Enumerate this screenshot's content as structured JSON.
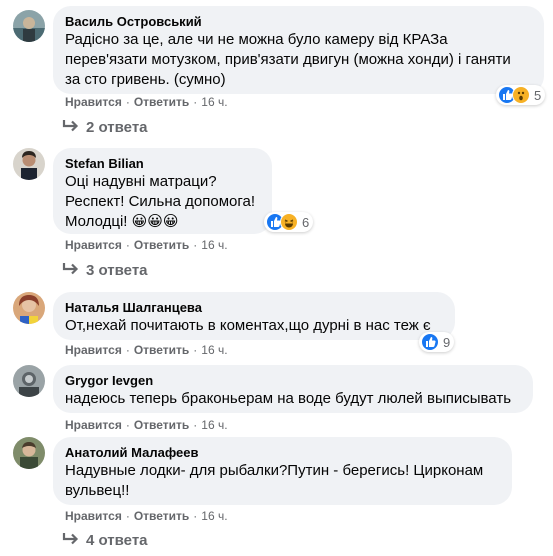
{
  "actions": {
    "like": "Нравится",
    "reply": "Ответить",
    "dot": "·"
  },
  "comments": [
    {
      "author": "Василь Островський",
      "text": "Радісно за це, але чи не можна було камеру від КРАЗа\nперев'язати мотузком, прив'язати двигун (можна хонди) і ганяти\nза сто гривень. (сумно)",
      "time": "16 ч.",
      "reactions": {
        "icons": [
          "like-icon",
          "wow-icon"
        ],
        "count": "5"
      },
      "replies": "2 ответа"
    },
    {
      "author": "Stefan Bilian",
      "text": "Оці надувні матраци?\nРеспект! Сильна допомога!\nМолодці! 😀😀😀",
      "time": "16 ч.",
      "reactions": {
        "icons": [
          "like-icon",
          "haha-icon"
        ],
        "count": "6"
      },
      "replies": "3 ответа"
    },
    {
      "author": "Наталья Шалганцева",
      "text": "От,нехай почитають в коментах,що дурні в нас теж є",
      "time": "16 ч.",
      "reactions": {
        "icons": [
          "like-icon"
        ],
        "count": "9"
      }
    },
    {
      "author": "Grygor Ievgen",
      "text": "надеюсь теперь браконьерам на воде будут люлей выписывать",
      "time": "16 ч."
    },
    {
      "author": "Анатолий Малафеев",
      "text": "Надувные лодки- для рыбалки?Путин - берегись! Цирконам\nвульвец!!",
      "time": "16 ч.",
      "replies": "4 ответа"
    }
  ],
  "colors": {
    "bubble": "#f0f2f5",
    "secondary_text": "#65676b",
    "like_blue": "#1877f2",
    "emoji_yellow": "#f7b125"
  }
}
